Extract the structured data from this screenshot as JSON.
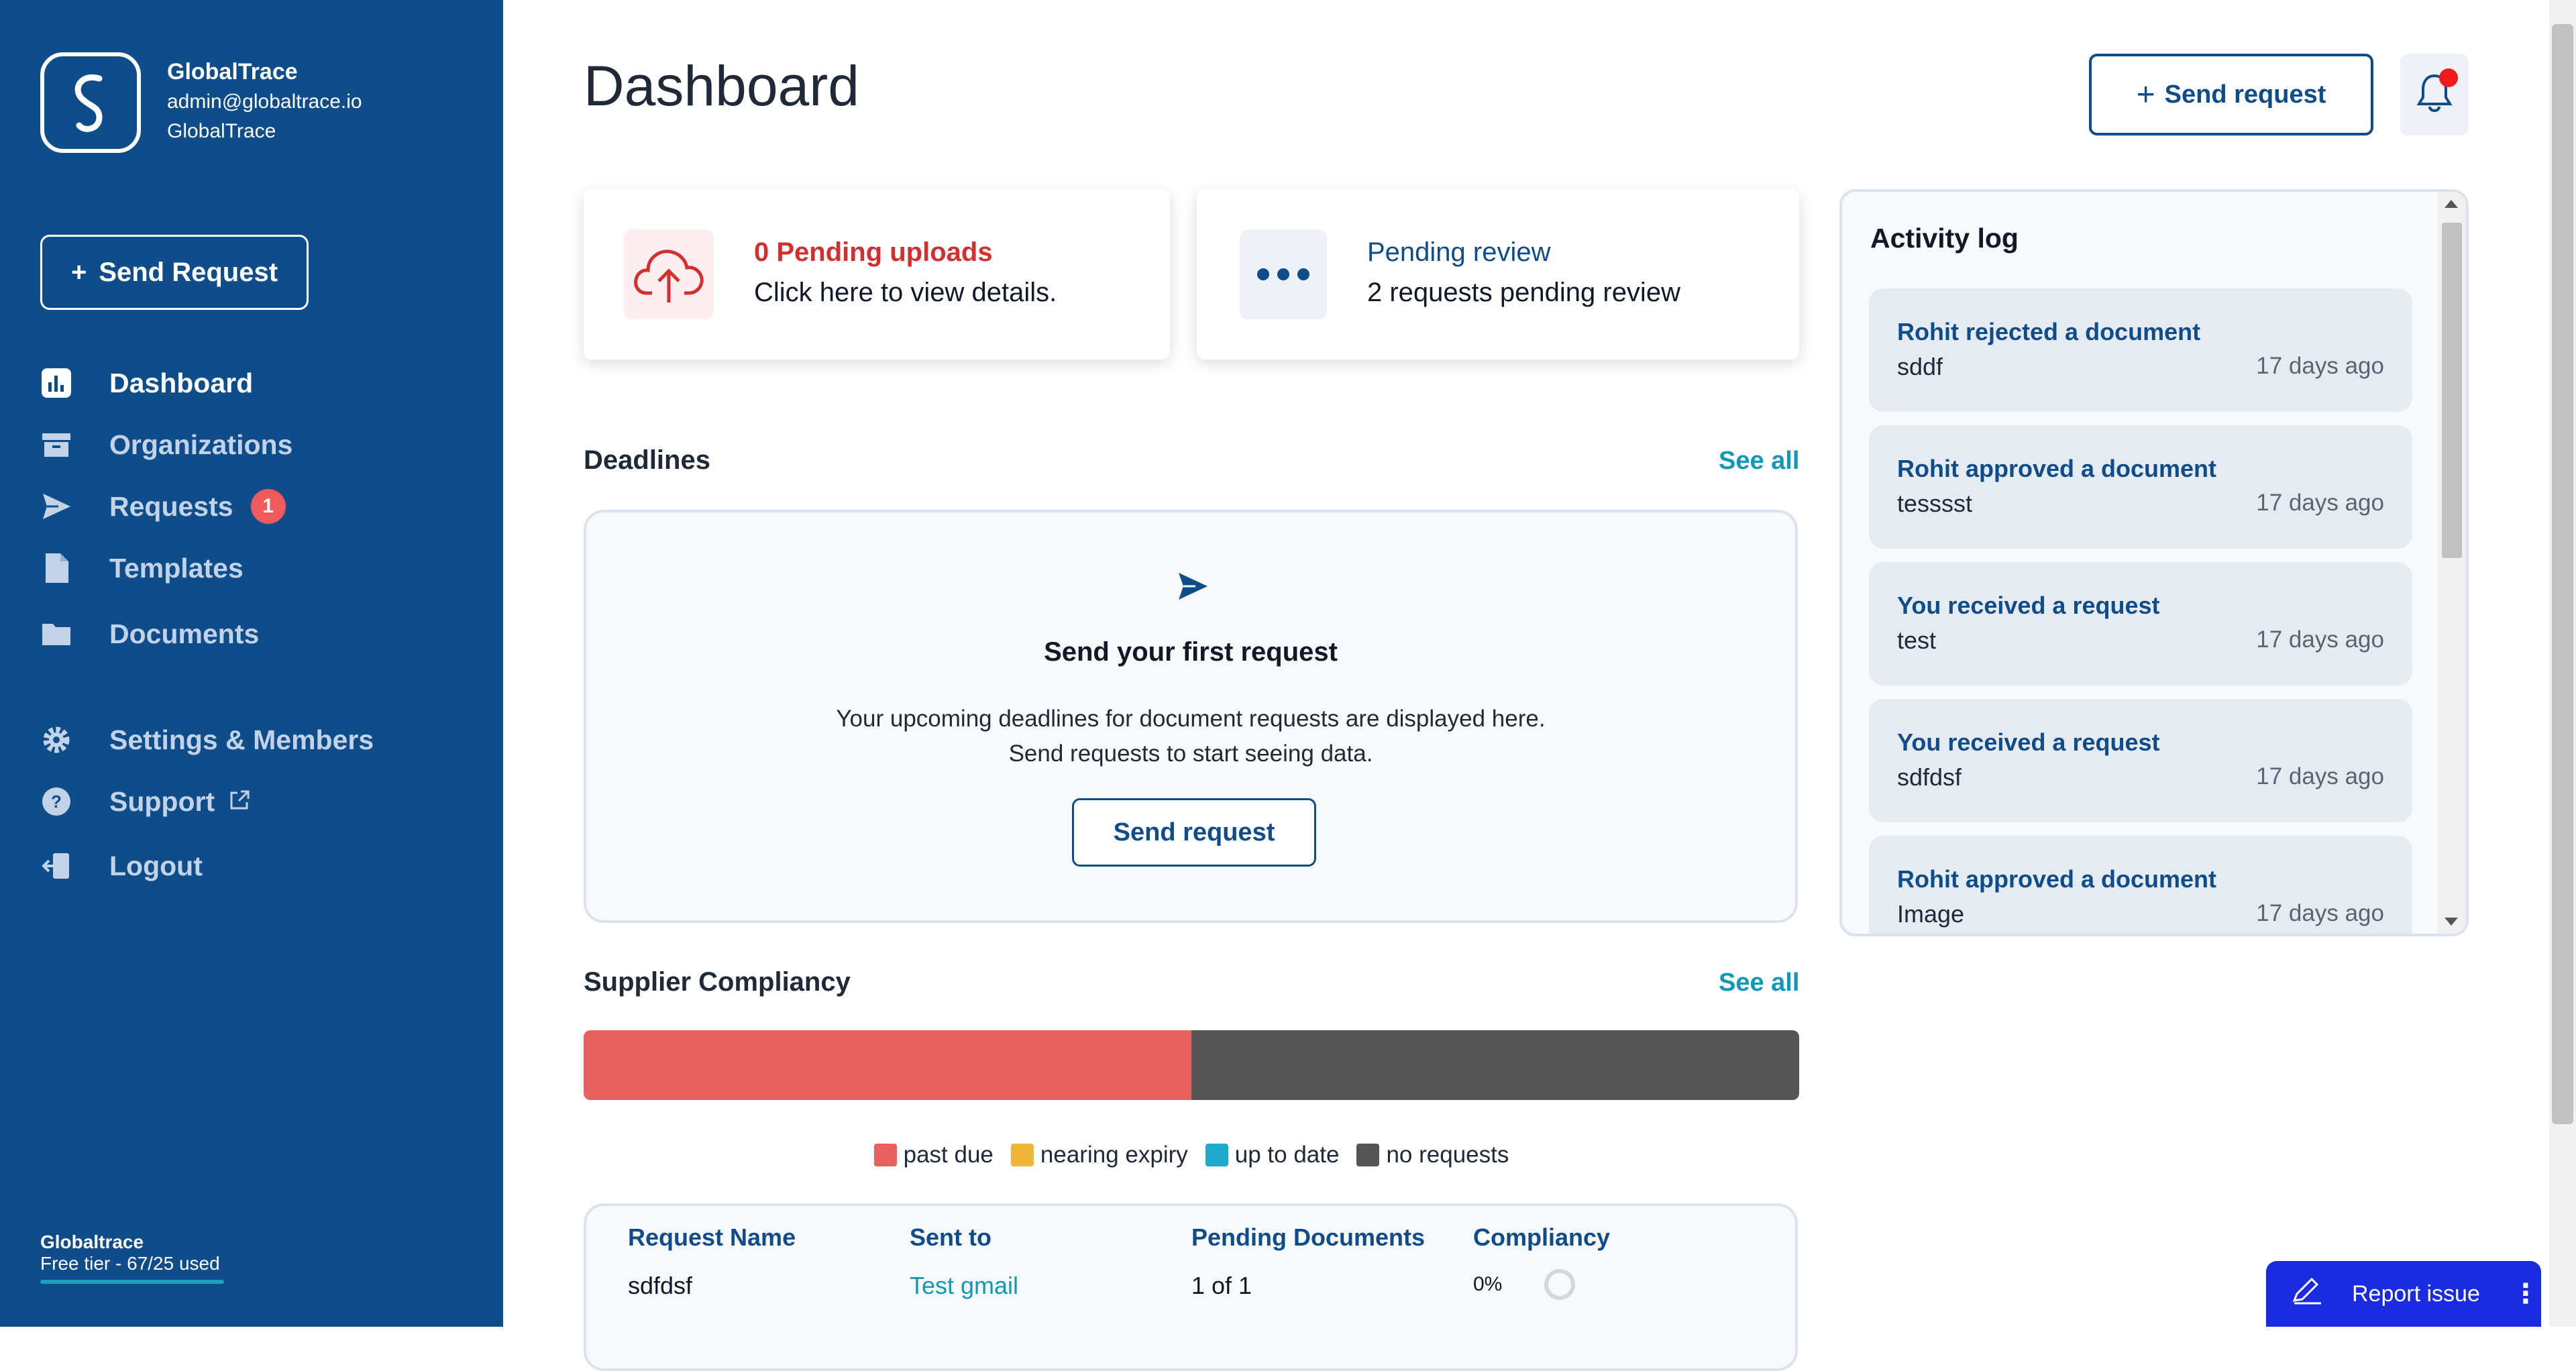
{
  "brand": {
    "name": "GlobalTrace",
    "email": "admin@globaltrace.io",
    "org": "GlobalTrace"
  },
  "sidebar": {
    "send_label": "Send Request",
    "items": [
      {
        "label": "Dashboard",
        "icon": "bar-chart-icon",
        "active": true
      },
      {
        "label": "Organizations",
        "icon": "archive-box-icon"
      },
      {
        "label": "Requests",
        "icon": "paper-plane-icon",
        "badge": "1"
      },
      {
        "label": "Templates",
        "icon": "file-icon"
      },
      {
        "label": "Documents",
        "icon": "folder-icon"
      },
      {
        "label": "Settings & Members",
        "icon": "gear-icon"
      },
      {
        "label": "Support",
        "icon": "help-circle-icon"
      },
      {
        "label": "Logout",
        "icon": "logout-icon"
      }
    ],
    "plan_name": "Globaltrace",
    "plan_usage": "Free tier - 67/25 used"
  },
  "header": {
    "title": "Dashboard",
    "send_label": "Send request"
  },
  "cards": {
    "uploads": {
      "title": "0 Pending uploads",
      "subtitle": "Click here to view details."
    },
    "review": {
      "title": "Pending review",
      "subtitle": "2 requests pending review"
    }
  },
  "deadlines": {
    "title": "Deadlines",
    "see_all": "See all",
    "empty_title": "Send your first request",
    "empty_line1": "Your upcoming deadlines for document requests are displayed here.",
    "empty_line2": "Send requests to start seeing data.",
    "button": "Send request"
  },
  "compliance": {
    "title": "Supplier Compliancy",
    "see_all": "See all",
    "segments": [
      {
        "label": "past due",
        "fraction": 0.5,
        "color": "#e96060"
      },
      {
        "label": "nearing expiry",
        "fraction": 0,
        "color": "#f0b63c"
      },
      {
        "label": "up to date",
        "fraction": 0,
        "color": "#1fa8c9"
      },
      {
        "label": "no requests",
        "fraction": 0.5,
        "color": "#555555"
      }
    ],
    "table": {
      "headers": [
        "Request Name",
        "Sent to",
        "Pending Documents",
        "Compliancy"
      ],
      "rows": [
        {
          "name": "sdfdsf",
          "sent_to": "Test gmail",
          "pending": "1 of 1",
          "compliancy": "0%"
        }
      ]
    }
  },
  "activity": {
    "title": "Activity log",
    "items": [
      {
        "title": "Rohit rejected a document",
        "subject": "sddf",
        "time": "17 days ago"
      },
      {
        "title": "Rohit approved a document",
        "subject": "tesssst",
        "time": "17 days ago"
      },
      {
        "title": "You received a request",
        "subject": "test",
        "time": "17 days ago"
      },
      {
        "title": "You received a request",
        "subject": "sdfdsf",
        "time": "17 days ago"
      },
      {
        "title": "Rohit approved a document",
        "subject": "Image",
        "time": "17 days ago"
      }
    ]
  },
  "report": {
    "label": "Report issue"
  },
  "colors": {
    "brand": "#0f4c8a",
    "accent": "#1098b8",
    "danger": "#d32f2f",
    "report": "#1a2be0"
  }
}
